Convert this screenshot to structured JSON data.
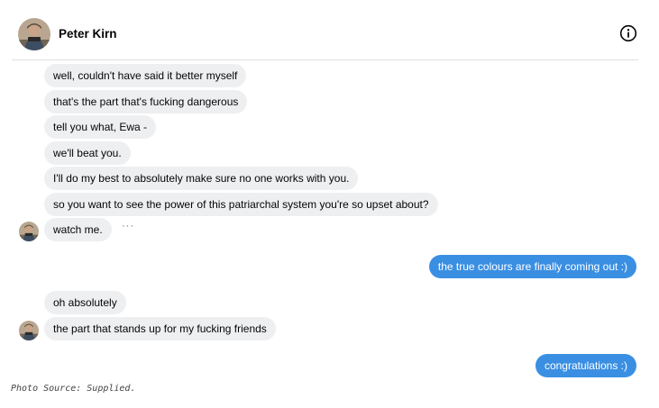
{
  "header": {
    "contact_name": "Peter Kirn",
    "info_icon": "info-circle-icon",
    "avatar_icon": "contact-avatar-photo"
  },
  "messages_group1": [
    "well, couldn't have said it better myself",
    "that's the part that's fucking dangerous",
    "tell you what, Ewa -",
    "we'll beat you.",
    "I'll do my best to absolutely make sure no one works with you.",
    "so you want to see the power of this patriarchal system you're so upset about?",
    "watch me."
  ],
  "more_options_icon": "ellipsis-icon",
  "sent_1": "the true colours are finally coming out :)",
  "messages_group2": [
    "oh absolutely",
    "the part that stands up for my fucking friends"
  ],
  "sent_2": "congratulations :)",
  "caption": "Photo Source: Supplied.",
  "colors": {
    "incoming_bubble": "#eeeff1",
    "outgoing_bubble": "#3a8fe3",
    "divider": "#dddfe2"
  }
}
